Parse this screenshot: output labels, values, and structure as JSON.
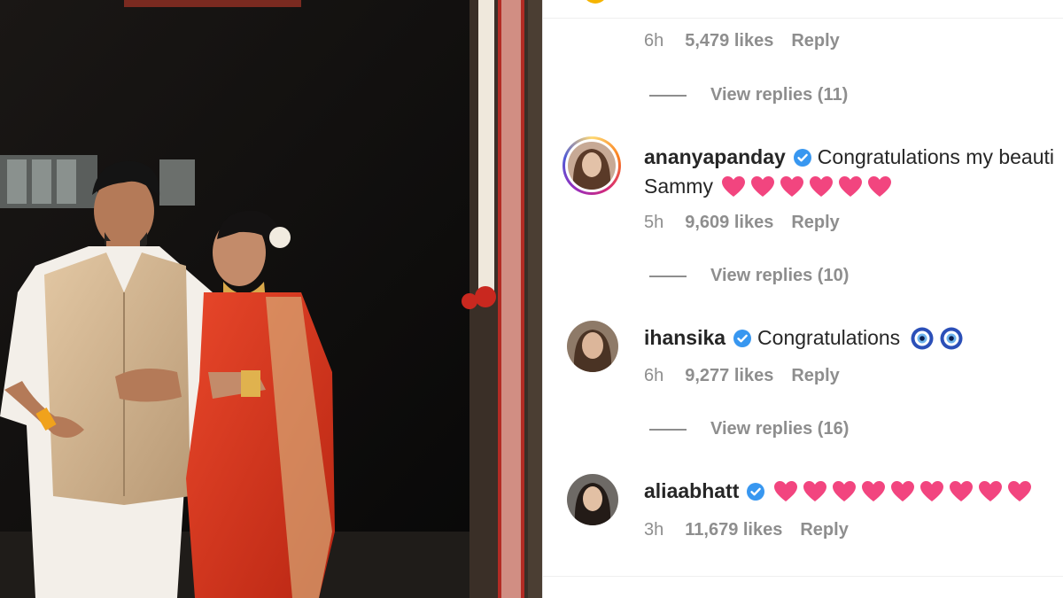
{
  "comments_panel": {
    "previous_comment": {
      "time": "6h",
      "likes": "5,479 likes",
      "reply_label": "Reply",
      "view_replies": "View replies (11)"
    },
    "comments": [
      {
        "username": "ananyapanday",
        "text_line1": "Congratulations my beauti",
        "text_line2": "Sammy",
        "emoji": [
          "pink-heart",
          "pink-heart",
          "pink-heart",
          "pink-heart",
          "pink-heart",
          "pink-heart"
        ],
        "time": "5h",
        "likes": "9,609 likes",
        "reply_label": "Reply",
        "view_replies": "View replies (10)"
      },
      {
        "username": "ihansika",
        "text": "Congratulations",
        "emoji": [
          "nazar-amulet",
          "nazar-amulet"
        ],
        "time": "6h",
        "likes": "9,277 likes",
        "reply_label": "Reply",
        "view_replies": "View replies (16)"
      },
      {
        "username": "aliaabhatt",
        "text": "",
        "emoji": [
          "pink-heart",
          "pink-heart",
          "pink-heart",
          "pink-heart",
          "pink-heart",
          "pink-heart",
          "pink-heart",
          "pink-heart",
          "pink-heart"
        ],
        "time": "3h",
        "likes": "11,679 likes",
        "reply_label": "Reply"
      }
    ]
  },
  "colors": {
    "verified_badge": "#3897f0",
    "meta_text": "#8e8e8e",
    "heart": "#f2457f",
    "nazar_blue": "#2b4fb8"
  }
}
